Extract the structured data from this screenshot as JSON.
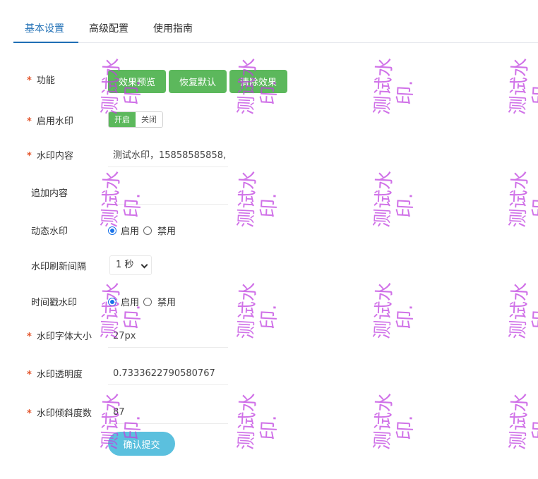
{
  "tabs": [
    {
      "label": "基本设置",
      "active": true
    },
    {
      "label": "高级配置",
      "active": false
    },
    {
      "label": "使用指南",
      "active": false
    }
  ],
  "form": {
    "feature": {
      "label": "功能",
      "required": true,
      "buttons": [
        "效果预览",
        "恢复默认",
        "清除效果"
      ]
    },
    "enable": {
      "label": "启用水印",
      "required": true,
      "on_label": "开启",
      "off_label": "关闭",
      "value": "开启"
    },
    "content": {
      "label": "水印内容",
      "required": true,
      "value": "测试水印，15858585858,"
    },
    "append": {
      "label": "追加内容",
      "required": false,
      "value": ""
    },
    "dynamic": {
      "label": "动态水印",
      "required": false,
      "options": [
        "启用",
        "禁用"
      ],
      "selected": "启用"
    },
    "interval": {
      "label": "水印刷新间隔",
      "required": false,
      "value": "1 秒"
    },
    "timestamp": {
      "label": "时间戳水印",
      "required": false,
      "options": [
        "启用",
        "禁用"
      ],
      "selected": "启用"
    },
    "font_size": {
      "label": "水印字体大小",
      "required": true,
      "value": "27px"
    },
    "opacity": {
      "label": "水印透明度",
      "required": true,
      "value": "0.7333622790580767"
    },
    "angle": {
      "label": "水印倾斜度数",
      "required": true,
      "value": "87"
    },
    "submit_label": "确认提交"
  },
  "watermark": {
    "line1": "测试水",
    "line2": "印.",
    "color": "#c040e0",
    "opacity": 0.7333622790580767,
    "angle_deg": 87
  }
}
